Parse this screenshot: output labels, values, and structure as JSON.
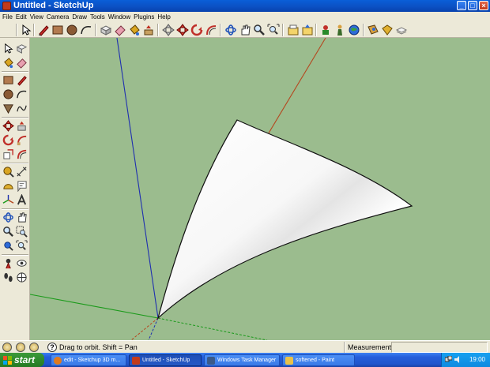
{
  "window": {
    "title": "Untitled - SketchUp",
    "controls": [
      "minimize",
      "maximize",
      "close"
    ]
  },
  "menubar": {
    "items": [
      "File",
      "Edit",
      "View",
      "Camera",
      "Draw",
      "Tools",
      "Window",
      "Plugins",
      "Help"
    ]
  },
  "toolbar": {
    "tools": [
      "select-icon",
      "pencil-icon",
      "rectangle-icon",
      "circle-icon",
      "arc-icon",
      "make-component-icon",
      "eraser-icon",
      "paint-bucket-icon",
      "push-pull-icon",
      "move-icon",
      "rotate-icon",
      "follow-me-icon",
      "orbit-icon",
      "pan-icon",
      "zoom-icon",
      "zoom-extents-icon",
      "get-models-icon",
      "share-model-icon",
      "components-icon",
      "google-earth-icon",
      "photo-textures-icon",
      "layers-icon"
    ]
  },
  "leftbar": {
    "tools": [
      "select-icon",
      "make-component-icon",
      "paint-bucket-icon",
      "eraser-icon",
      "rectangle-icon",
      "line-icon",
      "circle-icon",
      "arc-icon",
      "polygon-icon",
      "freehand-icon",
      "move-icon",
      "push-pull-icon",
      "rotate-icon",
      "follow-me-icon",
      "scale-icon",
      "offset-icon",
      "tape-measure-icon",
      "dimension-icon",
      "protractor-icon",
      "text-icon",
      "axes-icon",
      "3d-text-icon",
      "orbit-icon",
      "pan-icon",
      "zoom-icon",
      "zoom-window-icon",
      "previous-view-icon",
      "zoom-extents-icon",
      "position-camera-icon",
      "look-around-icon",
      "walk-icon",
      "section-plane-icon"
    ]
  },
  "colors": {
    "viewport_bg": "#9bbc8e",
    "axis_red": "#b5471f",
    "axis_green": "#1a9a1a",
    "axis_blue": "#1f2fb0",
    "surface": "#ffffff"
  },
  "statusbar": {
    "help_glyph": "?",
    "hint": "Drag to orbit.  Shift = Pan",
    "measurements_label": "Measurements",
    "measurements_value": ""
  },
  "taskbar": {
    "start_label": "start",
    "tasks": [
      {
        "label": "edit - Sketchup 3D m...",
        "icon": "firefox-icon",
        "active": false
      },
      {
        "label": "Untitled - SketchUp",
        "icon": "sketchup-icon",
        "active": true
      },
      {
        "label": "Windows Task Manager",
        "icon": "task-manager-icon",
        "active": false
      },
      {
        "label": "softened - Paint",
        "icon": "paint-icon",
        "active": false
      }
    ],
    "clock": "19:00"
  }
}
